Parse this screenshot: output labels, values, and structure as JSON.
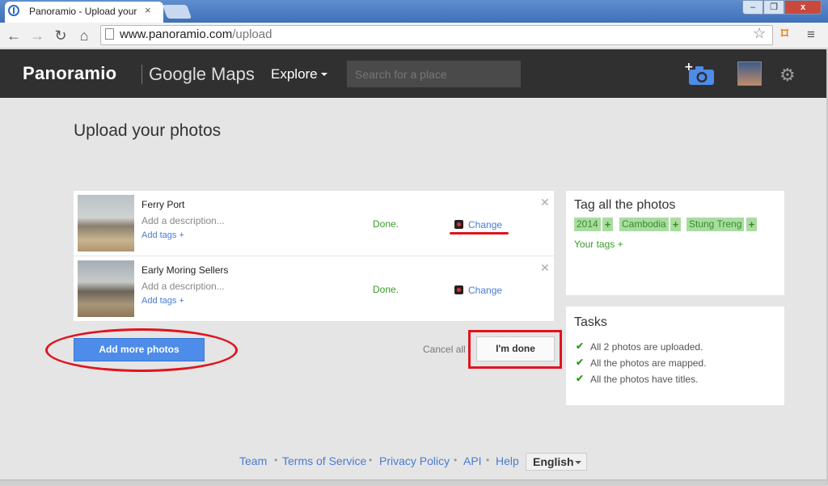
{
  "browser": {
    "tab_title": "Panoramio - Upload your",
    "tab_close": "×",
    "url_host": "www.panoramio.com",
    "url_path": "/upload",
    "win_min": "–",
    "win_max": "❐",
    "win_close": "x"
  },
  "header": {
    "logo": "Panoramio",
    "brand": "Google Maps",
    "explore_label": "Explore",
    "search_placeholder": "Search for a place"
  },
  "page": {
    "title": "Upload your photos"
  },
  "photos": [
    {
      "title": "Ferry Port",
      "description_placeholder": "Add a description...",
      "add_tags": "Add tags +",
      "status": "Done.",
      "change_label": "Change"
    },
    {
      "title": "Early Moring Sellers",
      "description_placeholder": "Add a description...",
      "add_tags": "Add tags +",
      "status": "Done.",
      "change_label": "Change"
    }
  ],
  "actions": {
    "add_more": "Add more photos",
    "cancel_all": "Cancel all",
    "done": "I'm done"
  },
  "tag_panel": {
    "title": "Tag all the photos",
    "tags": [
      "2014",
      "Cambodia",
      "Stung Treng"
    ],
    "plus": "+",
    "your_tags": "Your tags +"
  },
  "tasks": {
    "title": "Tasks",
    "items": [
      "All 2 photos are uploaded.",
      "All the photos are mapped.",
      "All the photos have titles."
    ],
    "check": "✔"
  },
  "footer": {
    "links": [
      "Team",
      "Terms of Service",
      "Privacy Policy",
      "API",
      "Help"
    ],
    "separator": "•",
    "language": "English"
  },
  "colors": {
    "header_bg": "#303030",
    "primary_button": "#4d8ce8",
    "tag_chip": "#a9dda0",
    "annotation_red": "#e0141e"
  }
}
